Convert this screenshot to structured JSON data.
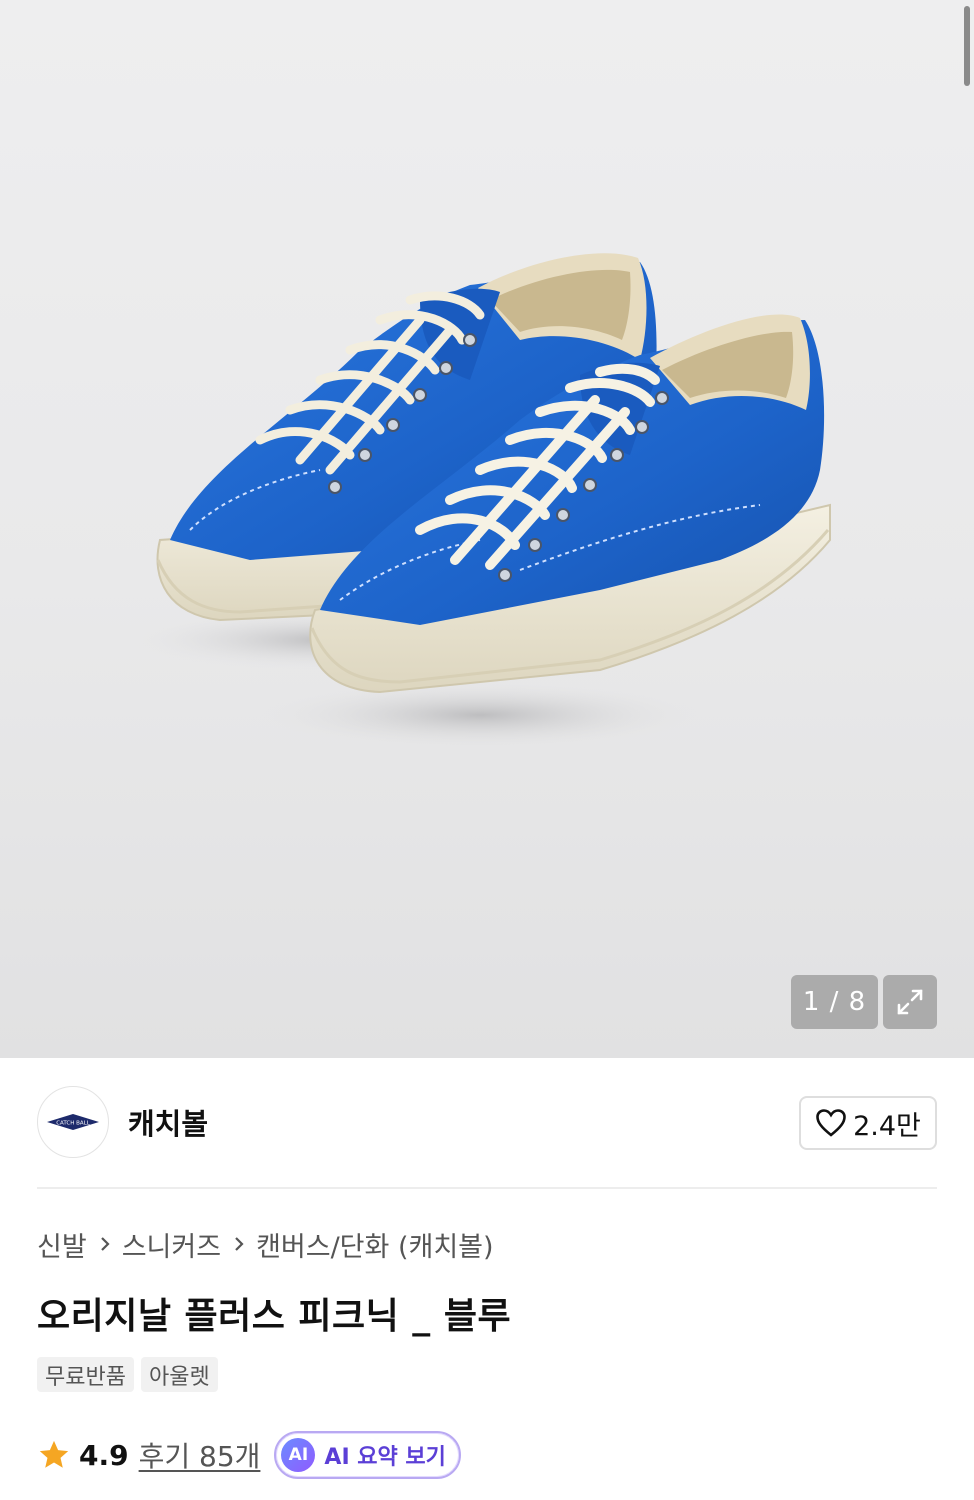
{
  "gallery": {
    "image_subject": "blue canvas sneakers product photo",
    "counter": "1 / 8",
    "current_index": 1,
    "total_images": 8
  },
  "brand": {
    "name": "캐치볼",
    "logo_text": "CATCH BALL",
    "like_count": "2.4만"
  },
  "breadcrumb": {
    "items": [
      "신발",
      "스니커즈",
      "캔버스/단화 (캐치볼)"
    ]
  },
  "product": {
    "title": "오리지날 플러스 피크닉 _ 블루",
    "tags": [
      "무료반품",
      "아울렛"
    ]
  },
  "rating": {
    "score": "4.9",
    "reviews_label": "후기 85개",
    "ai_badge": "AI",
    "ai_summary_label": "AI 요약 보기"
  },
  "colors": {
    "shoe_blue": "#1d63c9",
    "sole_cream": "#ece7d4",
    "star": "#f5a623",
    "ai_accent": "#7a5cff"
  }
}
